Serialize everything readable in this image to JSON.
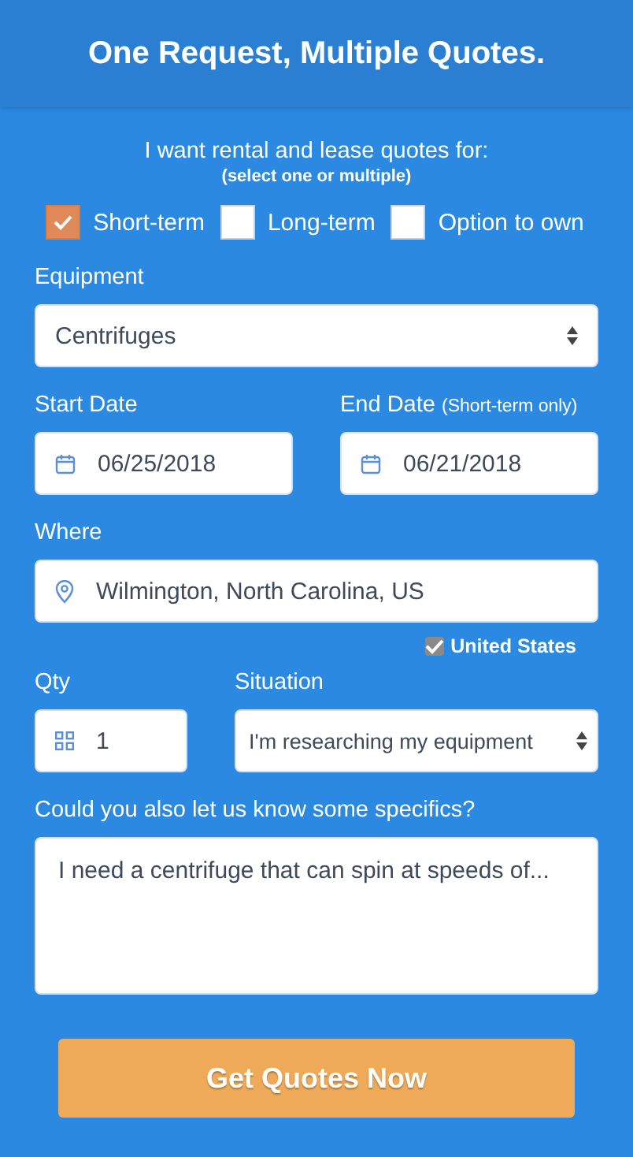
{
  "header": {
    "title": "One Request, Multiple Quotes."
  },
  "intro": {
    "heading": "I want rental and lease quotes for:",
    "hint": "(select one or multiple)"
  },
  "options": [
    {
      "label": "Short-term",
      "checked": true
    },
    {
      "label": "Long-term",
      "checked": false
    },
    {
      "label": "Option to own",
      "checked": false
    }
  ],
  "equipment": {
    "label": "Equipment",
    "value": "Centrifuges"
  },
  "start_date": {
    "label": "Start Date",
    "value": "06/25/2018"
  },
  "end_date": {
    "label": "End Date",
    "note": "(Short-term only)",
    "value": "06/21/2018"
  },
  "where": {
    "label": "Where",
    "value": "Wilmington, North Carolina, US",
    "country": {
      "label": "United States",
      "checked": true
    }
  },
  "qty": {
    "label": "Qty",
    "value": "1"
  },
  "situation": {
    "label": "Situation",
    "value": "I'm researching my equipment"
  },
  "specifics": {
    "label": "Could you also let us know some specifics?",
    "value": "I need a centrifuge that can spin at speeds of..."
  },
  "submit": {
    "label": "Get Quotes Now"
  }
}
